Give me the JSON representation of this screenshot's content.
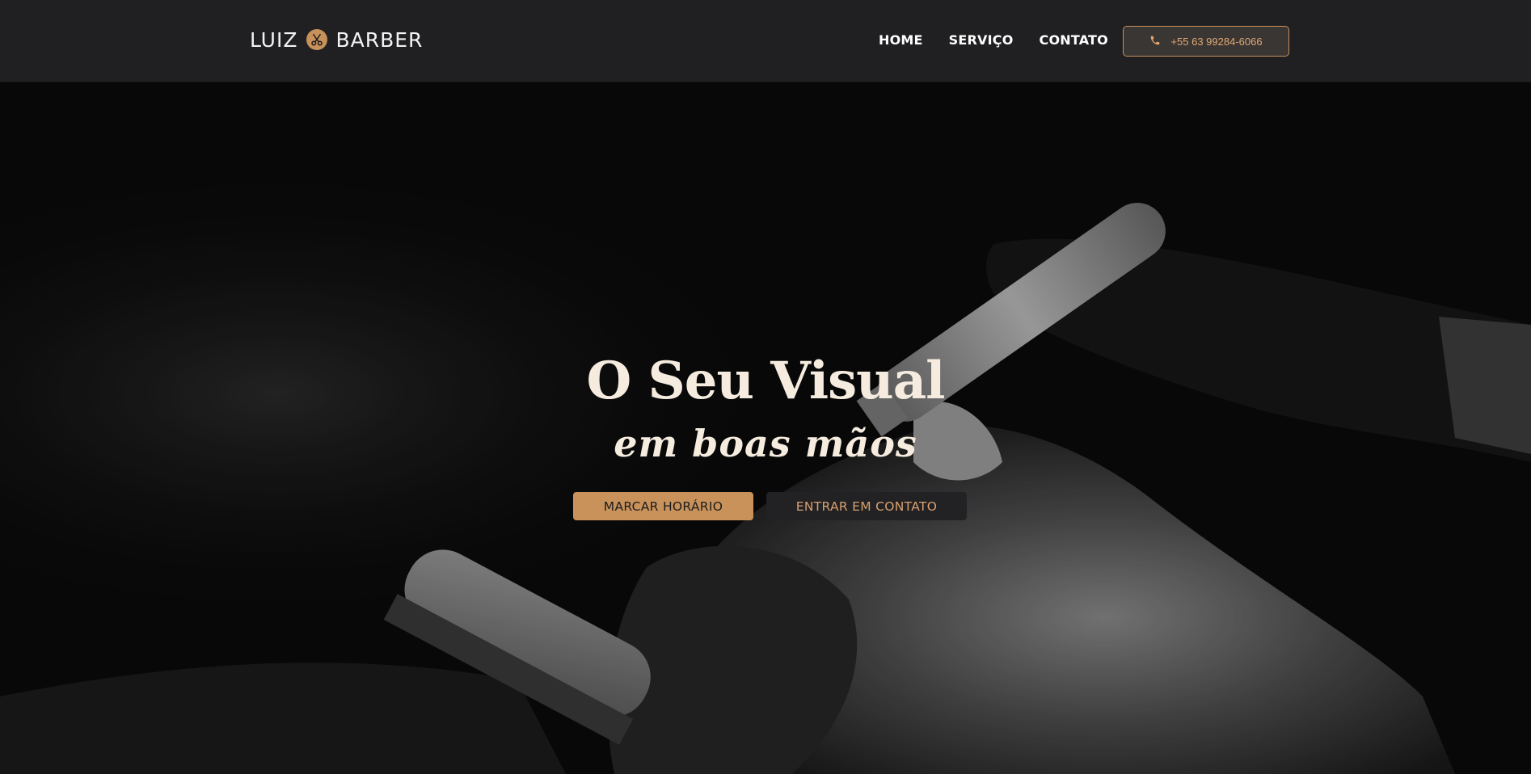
{
  "brand": {
    "name_left": "LUIZ",
    "name_right": "BARBER",
    "logo_icon": "scissors-icon",
    "accent_color": "#c8905a"
  },
  "nav": {
    "items": [
      {
        "label": "HOME"
      },
      {
        "label": "SERVIÇO"
      },
      {
        "label": "CONTATO"
      }
    ],
    "phone": {
      "icon": "phone-icon",
      "label": "+55 63 99284-6066"
    }
  },
  "hero": {
    "headline": "O Seu Visual",
    "subline": "em boas mãos",
    "primary_button": "MARCAR HORÁRIO",
    "secondary_button": "ENTRAR EM CONTATO",
    "background_image": "barber-trimming-beard-photo"
  },
  "colors": {
    "header_bg": "#202022",
    "hero_text": "#f5ecdf",
    "primary_button_bg": "#c9925b",
    "secondary_button_bg": "#222224"
  }
}
